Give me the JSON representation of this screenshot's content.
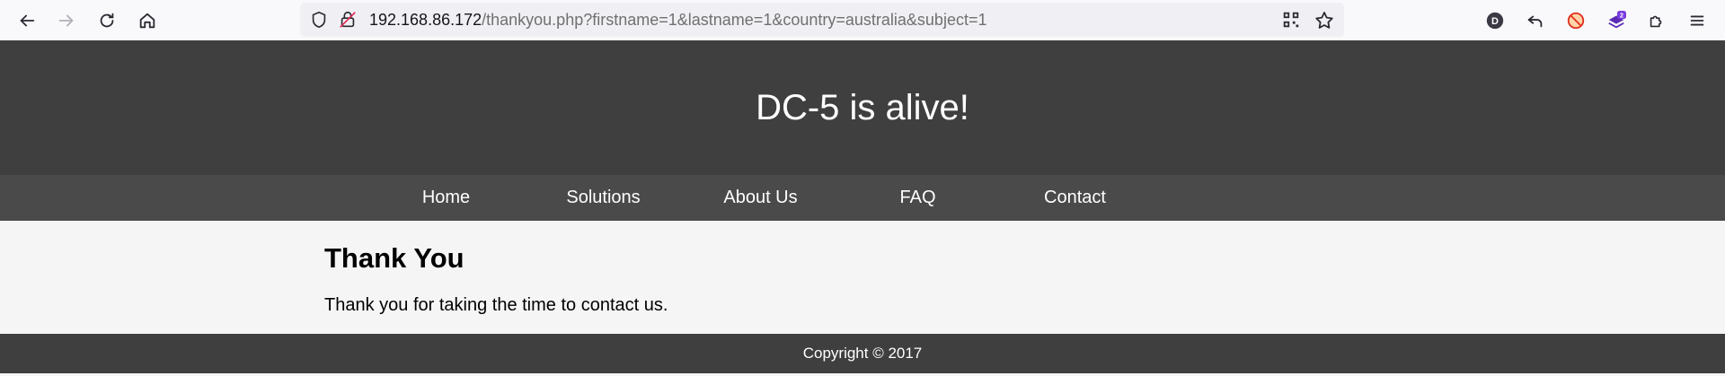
{
  "browser": {
    "url_host": "192.168.86.172",
    "url_path": "/thankyou.php?firstname=1&lastname=1&country=australia&subject=1",
    "profile_initial": "D",
    "extension_badge": "2",
    "icons": {
      "back": "back-arrow-icon",
      "forward": "forward-arrow-icon",
      "reload": "reload-icon",
      "home": "home-icon",
      "shield": "tracking-shield-icon",
      "insecure": "insecure-lock-icon",
      "qr": "qr-code-icon",
      "bookmark": "bookmark-star-icon",
      "profile": "profile-avatar-icon",
      "undo": "undo-arrow-icon",
      "blocker": "blocker-icon",
      "extension": "extension-badge-icon",
      "puzzle": "extensions-puzzle-icon",
      "menu": "hamburger-menu-icon"
    }
  },
  "site": {
    "title": "DC-5 is alive!",
    "nav": [
      "Home",
      "Solutions",
      "About Us",
      "FAQ",
      "Contact"
    ],
    "heading": "Thank You",
    "message": "Thank you for taking the time to contact us.",
    "footer": "Copyright © 2017"
  },
  "colors": {
    "header_bg": "#3f3f3f",
    "nav_bg": "#4a4a4a",
    "content_bg": "#f5f5f5",
    "toolbar_bg": "#f9f9fb",
    "urlbar_bg": "#f0f0f4"
  }
}
